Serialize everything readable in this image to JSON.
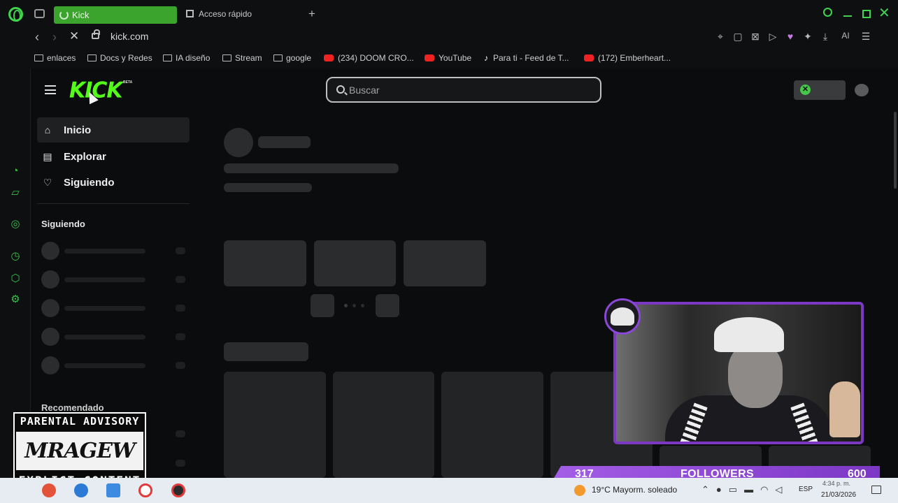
{
  "browser": {
    "tabs": [
      {
        "label": "Kick",
        "active": true,
        "loading": true
      },
      {
        "label": "Acceso rápido",
        "active": false
      }
    ],
    "new_tab_symbol": "+",
    "url": "kick.com",
    "bookmarks": [
      {
        "label": "enlaces",
        "type": "folder"
      },
      {
        "label": "Docs y Redes",
        "type": "folder"
      },
      {
        "label": "IA diseño",
        "type": "folder"
      },
      {
        "label": "Stream",
        "type": "folder"
      },
      {
        "label": "google",
        "type": "folder"
      },
      {
        "label": "(234) DOOM CRO...",
        "type": "youtube"
      },
      {
        "label": "YouTube",
        "type": "youtube"
      },
      {
        "label": "Para ti - Feed de T...",
        "type": "tiktok"
      },
      {
        "label": "(172) Emberheart...",
        "type": "youtube"
      }
    ],
    "toolbar_ai_label": "AI",
    "accent_color": "#3fd34f"
  },
  "kick": {
    "logo_text": "KICK",
    "beta_label": "BETA",
    "brand_color": "#53fc18",
    "search": {
      "placeholder": "Buscar",
      "value": ""
    },
    "nav": {
      "inicio": "Inicio",
      "explorar": "Explorar",
      "siguiendo": "Siguiendo"
    },
    "sections": {
      "following": "Siguiendo",
      "recommended": "Recomendado"
    }
  },
  "overlay": {
    "followers_current": "317",
    "followers_label": "FOLLOWERS",
    "followers_goal": "600",
    "advisory": {
      "top": "PARENTAL ADVISORY",
      "middle": "MRAGEW",
      "bottom": "EXPLICT CONTENT"
    },
    "frame_color": "#7d38c3"
  },
  "taskbar": {
    "weather": "19°C  Mayorm. soleado",
    "language": "ESP",
    "time": "4:34 p. m.",
    "date": "21/03/2026"
  }
}
